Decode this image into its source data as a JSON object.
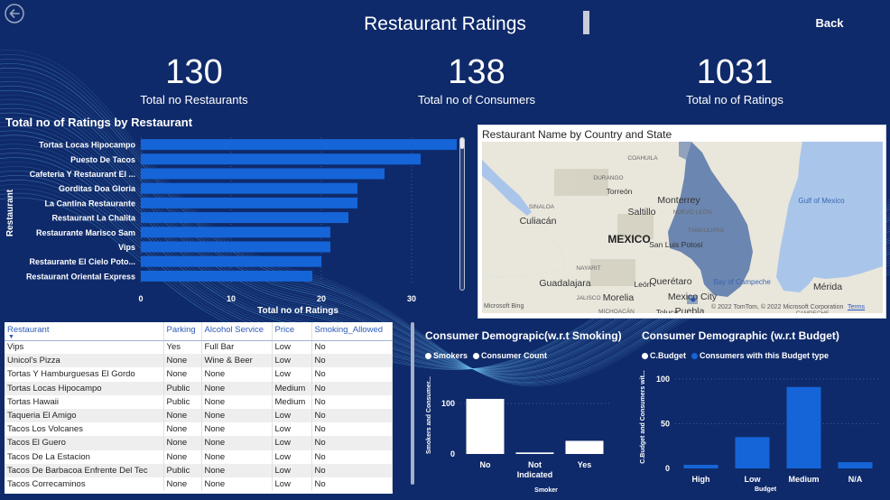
{
  "header": {
    "title": "Restaurant Ratings",
    "back_label": "Back"
  },
  "kpis": [
    {
      "value": "130",
      "label": "Total no Restaurants"
    },
    {
      "value": "138",
      "label": "Total no of Consumers"
    },
    {
      "value": "1031",
      "label": "Total no of Ratings"
    }
  ],
  "icons": {
    "back": "back-arrow-circle-icon",
    "sort": "sort-down-caret-icon",
    "bing": "microsoft-bing-logo-icon"
  },
  "colors": {
    "background": "#0f2a6a",
    "bar": "#1565d8",
    "white_bar": "#ffffff",
    "table_header_text": "#2d5bb9"
  },
  "bar_chart": {
    "title": "Total no of Ratings by Restaurant",
    "chart_data": {
      "type": "bar",
      "orientation": "horizontal",
      "categories": [
        "Tortas Locas Hipocampo",
        "Puesto De Tacos",
        "Cafeteria Y Restaurant El ...",
        "Gorditas Doa Gloria",
        "La Cantina Restaurante",
        "Restaurant La Chalita",
        "Restaurante Marisco Sam",
        "Vips",
        "Restaurante El Cielo Poto...",
        "Restaurant Oriental Express"
      ],
      "values": [
        35,
        31,
        27,
        24,
        24,
        23,
        21,
        21,
        20,
        19
      ],
      "xlabel": "Total no of Ratings",
      "ylabel": "Restaurant",
      "xticks": [
        "0",
        "10",
        "20",
        "30"
      ],
      "xlim": [
        0,
        35
      ]
    }
  },
  "map": {
    "title": "Restaurant Name by Country and State",
    "labels": [
      {
        "text": "COAHUILA",
        "size": "small"
      },
      {
        "text": "DURANGO",
        "size": "small"
      },
      {
        "text": "Torreón",
        "size": "med"
      },
      {
        "text": "Monterrey",
        "size": "big"
      },
      {
        "text": "NUEVO LEÓN",
        "size": "small"
      },
      {
        "text": "Saltillo",
        "size": "big"
      },
      {
        "text": "SINALOA",
        "size": "small"
      },
      {
        "text": "Culiacán",
        "size": "big"
      },
      {
        "text": "Gulf of Mexico",
        "size": "sea"
      },
      {
        "text": "MEXICO",
        "size": "country"
      },
      {
        "text": "TAMAULIPAS",
        "size": "small"
      },
      {
        "text": "San Luis Potosí",
        "size": "med"
      },
      {
        "text": "NAYARIT",
        "size": "small"
      },
      {
        "text": "Guadalajara",
        "size": "big"
      },
      {
        "text": "León",
        "size": "med"
      },
      {
        "text": "Querétaro",
        "size": "big"
      },
      {
        "text": "Bay of Campeche",
        "size": "sea"
      },
      {
        "text": "Mérida",
        "size": "big"
      },
      {
        "text": "JALISCO",
        "size": "small"
      },
      {
        "text": "Morelia",
        "size": "big"
      },
      {
        "text": "Mexico City",
        "size": "big"
      },
      {
        "text": "MICHOACÁN",
        "size": "small"
      },
      {
        "text": "Puebla",
        "size": "big"
      },
      {
        "text": "CAMPECHE",
        "size": "small"
      },
      {
        "text": "Toluca",
        "size": "med"
      }
    ],
    "bing_label": "Microsoft Bing",
    "copyright": "© 2022 TomTom, © 2022 Microsoft Corporation",
    "terms": "Terms"
  },
  "table": {
    "columns": [
      "Restaurant",
      "Parking",
      "Alcohol Service",
      "Price",
      "Smoking_Allowed"
    ],
    "rows": [
      [
        "Vips",
        "Yes",
        "Full Bar",
        "Low",
        "No"
      ],
      [
        "Unicol's Pizza",
        "None",
        "Wine & Beer",
        "Low",
        "No"
      ],
      [
        "Tortas Y Hamburguesas El Gordo",
        "None",
        "None",
        "Low",
        "No"
      ],
      [
        "Tortas Locas Hipocampo",
        "Public",
        "None",
        "Medium",
        "No"
      ],
      [
        "Tortas Hawaii",
        "Public",
        "None",
        "Medium",
        "No"
      ],
      [
        "Taqueria El Amigo",
        "None",
        "None",
        "Low",
        "No"
      ],
      [
        "Tacos Los Volcanes",
        "None",
        "None",
        "Low",
        "No"
      ],
      [
        "Tacos El Guero",
        "None",
        "None",
        "Low",
        "No"
      ],
      [
        "Tacos De La Estacion",
        "None",
        "None",
        "Low",
        "No"
      ],
      [
        "Tacos De Barbacoa Enfrente Del Tec",
        "Public",
        "None",
        "Low",
        "No"
      ],
      [
        "Tacos Correcaminos",
        "None",
        "None",
        "Low",
        "No"
      ]
    ]
  },
  "smoking_chart": {
    "title": "Consumer Demograpic(w.r.t Smoking)",
    "legend": [
      "Smokers",
      "Consumer Count"
    ],
    "chart_data": {
      "type": "bar",
      "categories": [
        "No",
        "Not Indicated",
        "Yes"
      ],
      "values": [
        109,
        3,
        26
      ],
      "xlabel": "Smoker",
      "ylabel": "Smokers and Consumer...",
      "yticks": [
        "0",
        "100"
      ],
      "ylim": [
        0,
        140
      ]
    }
  },
  "budget_chart": {
    "title": "Consumer Demographic (w.r.t Budget)",
    "legend": [
      "C.Budget",
      "Consumers with this Budget type"
    ],
    "chart_data": {
      "type": "bar",
      "categories": [
        "High",
        "Low",
        "Medium",
        "N/A"
      ],
      "values": [
        4,
        35,
        91,
        7
      ],
      "xlabel": "Budget",
      "ylabel": "C.Budget and Consumers wit...",
      "yticks": [
        "0",
        "50",
        "100"
      ],
      "ylim": [
        0,
        110
      ]
    }
  }
}
